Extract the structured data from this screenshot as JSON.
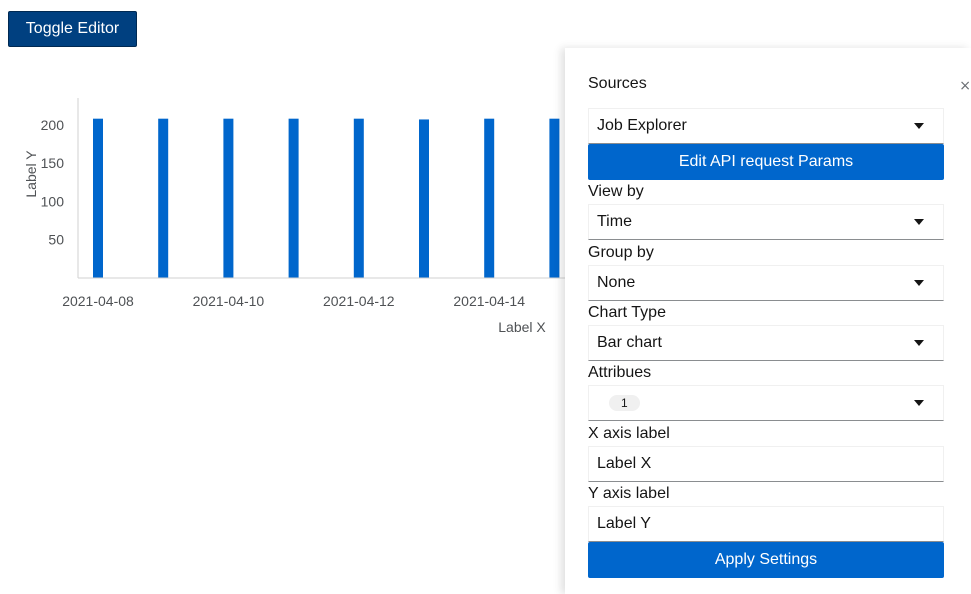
{
  "header": {
    "toggle_label": "Toggle Editor"
  },
  "chart_data": {
    "type": "bar",
    "x": [
      "2021-04-08",
      "2021-04-09",
      "2021-04-10",
      "2021-04-11",
      "2021-04-12",
      "2021-04-13",
      "2021-04-14",
      "2021-04-15"
    ],
    "values": [
      208,
      208,
      208,
      208,
      208,
      207,
      208,
      208
    ],
    "x_tick_labels": [
      "2021-04-08",
      "2021-04-10",
      "2021-04-12",
      "2021-04-14"
    ],
    "y_ticks": [
      50,
      100,
      150,
      200
    ],
    "ylim": [
      0,
      235
    ],
    "xlabel": "Label X",
    "ylabel": "Label Y",
    "bar_color": "#0066cc"
  },
  "editor": {
    "close_symbol": "×",
    "sources_label": "Sources",
    "sources_value": "Job Explorer",
    "edit_params_label": "Edit API request Params",
    "view_by_label": "View by",
    "view_by_value": "Time",
    "group_by_label": "Group by",
    "group_by_value": "None",
    "chart_type_label": "Chart Type",
    "chart_type_value": "Bar chart",
    "attributes_label": "Attribues",
    "attributes_count": "1",
    "x_axis_label_label": "X axis label",
    "x_axis_label_value": "Label X",
    "y_axis_label_label": "Y axis label",
    "y_axis_label_value": "Label Y",
    "apply_label": "Apply Settings"
  },
  "colors": {
    "primary": "#0066cc",
    "toggle_bg": "#004080"
  }
}
